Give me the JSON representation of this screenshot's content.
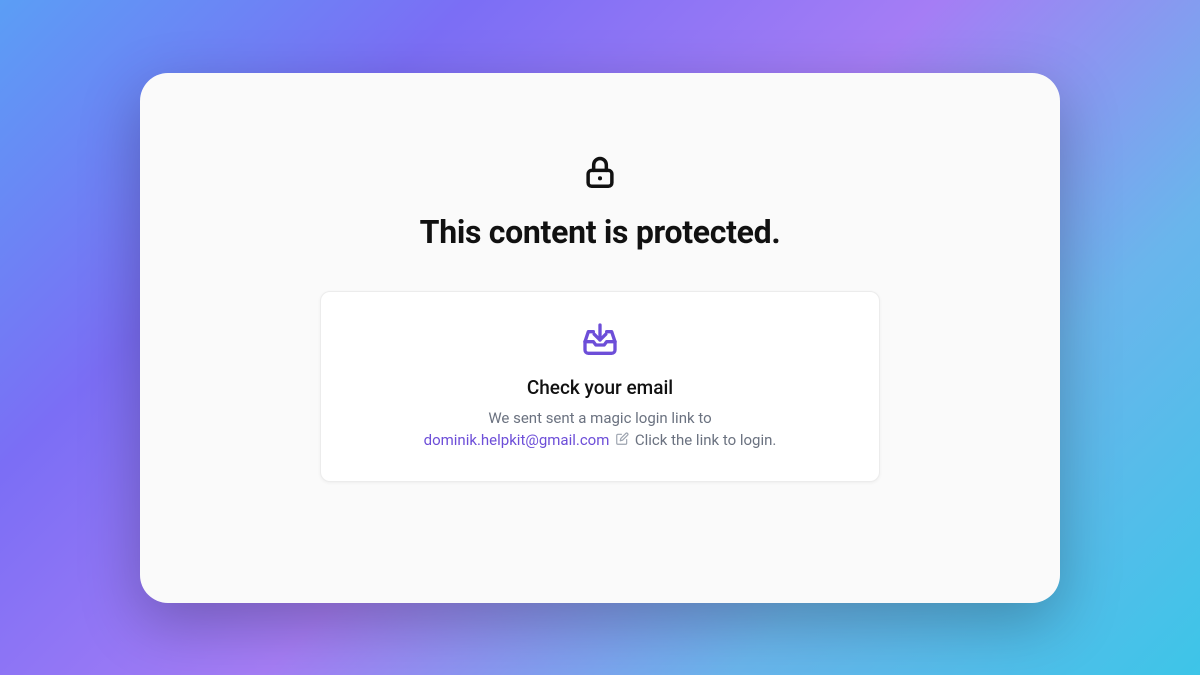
{
  "header": {
    "title": "This content is protected."
  },
  "card": {
    "title": "Check your email",
    "message_before": "We sent sent a magic login link to",
    "email": "dominik.helpkit@gmail.com",
    "message_after": "Click the link to login."
  },
  "colors": {
    "accent": "#6d4ed8"
  }
}
